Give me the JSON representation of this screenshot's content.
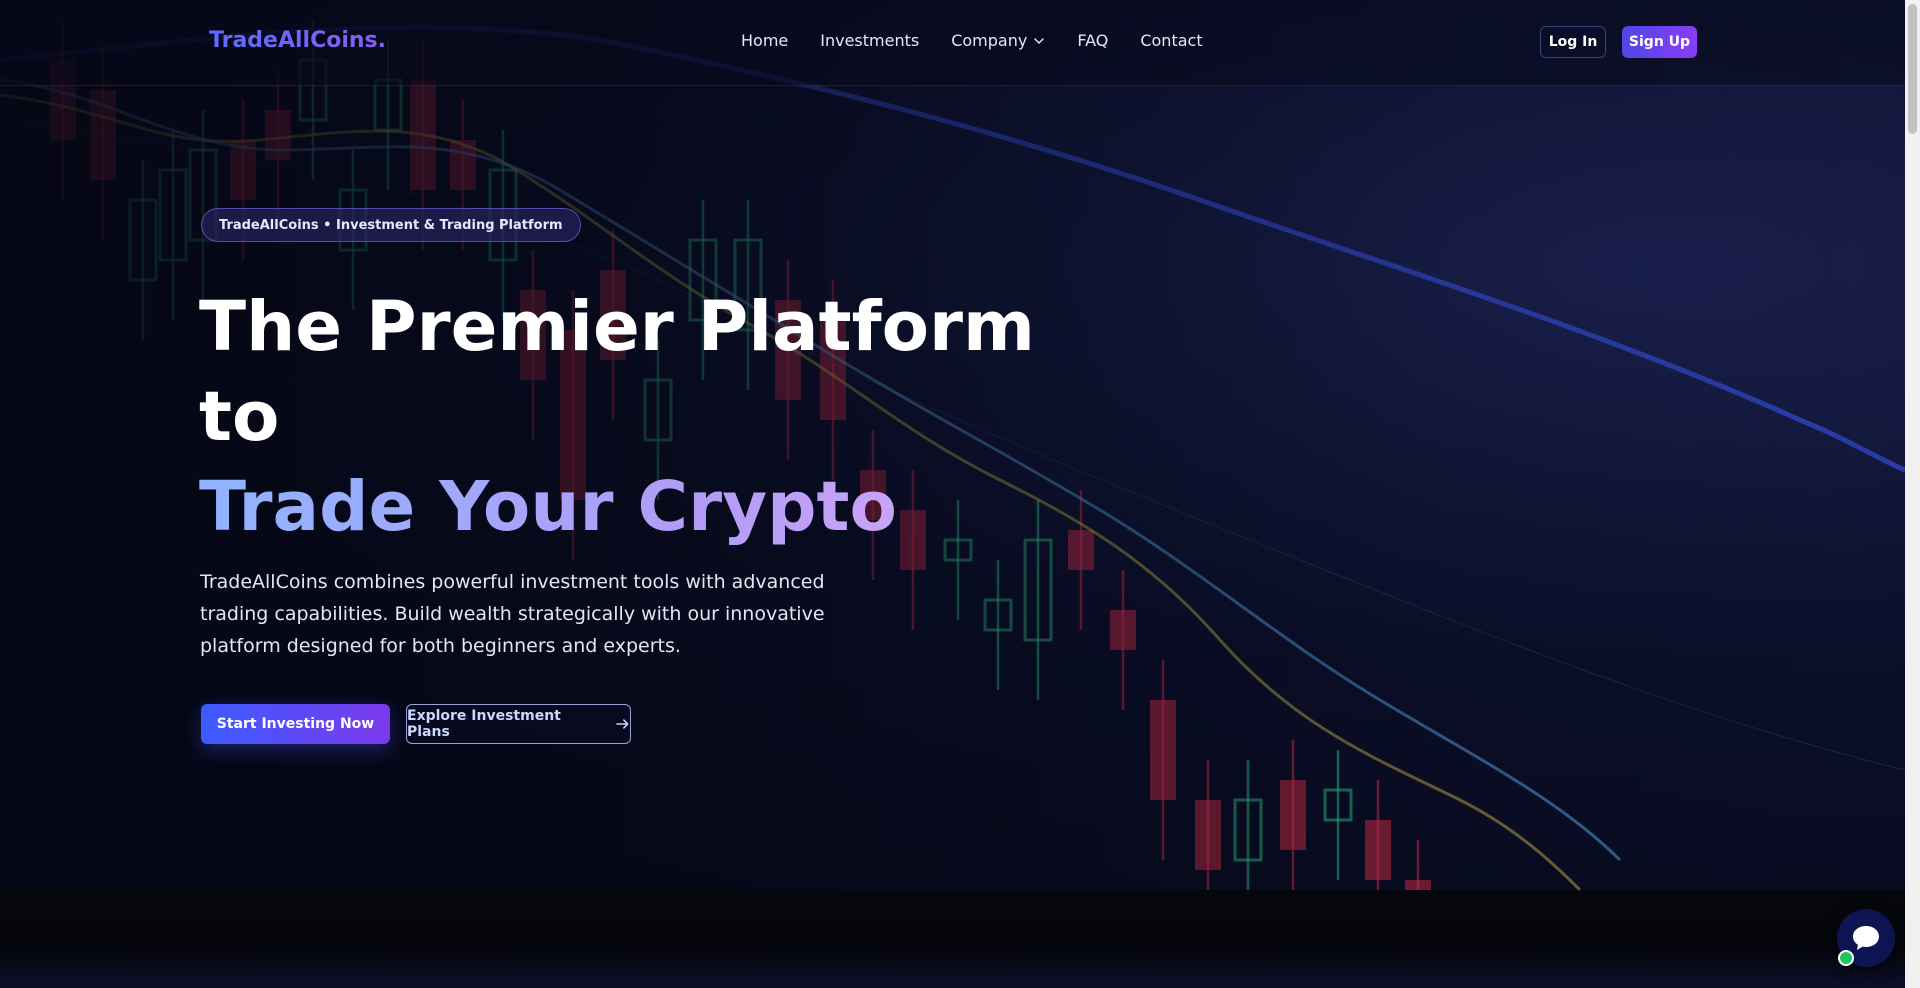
{
  "brand": {
    "logo_text": "TradeAllCoins."
  },
  "nav": {
    "items": [
      {
        "label": "Home"
      },
      {
        "label": "Investments"
      },
      {
        "label": "Company"
      },
      {
        "label": "FAQ"
      },
      {
        "label": "Contact"
      }
    ],
    "login_label": "Log In",
    "signup_label": "Sign Up"
  },
  "hero": {
    "badge": "TradeAllCoins • Investment & Trading Platform",
    "headline_line1": "The Premier Platform",
    "headline_line2": "to",
    "headline_line3": "Trade Your Crypto",
    "description": "TradeAllCoins combines powerful investment tools with advanced trading capabilities. Build wealth strategically with our innovative platform designed for both beginners and experts.",
    "primary_cta": "Start Investing Now",
    "secondary_cta": "Explore Investment Plans"
  },
  "colors": {
    "accent": "#4f46e5",
    "accent_secondary": "#8b3cf7",
    "candle_up": "#2ecf8a",
    "candle_down": "#e0304a",
    "online_status": "#22c55e"
  },
  "icons": {
    "company_dropdown": "chevron-down-icon",
    "secondary_cta_arrow": "arrow-right-icon",
    "chat": "chat-bubble-icon"
  }
}
